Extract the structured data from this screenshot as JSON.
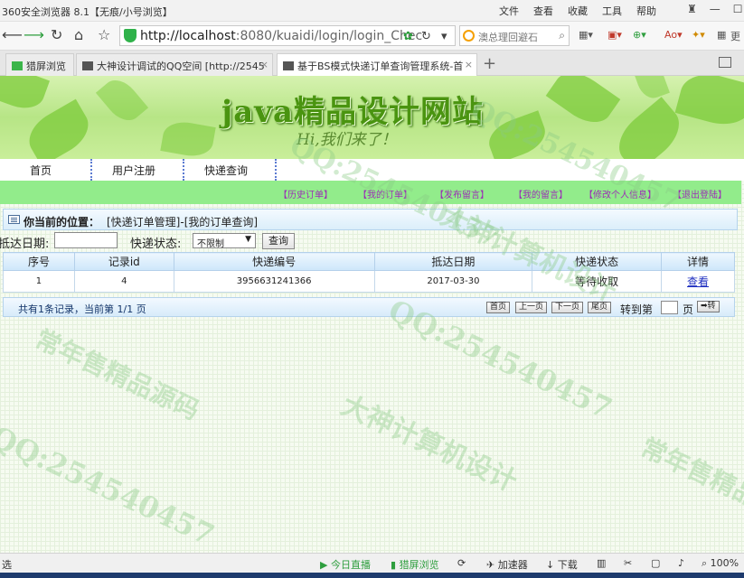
{
  "browser": {
    "window_title": "360安全浏览器 8.1【无痕/小号浏览】",
    "menu_items": [
      "文件",
      "查看",
      "收藏",
      "工具",
      "帮助"
    ],
    "url_host": "http://localhost",
    "url_rest": ":8080/kuaidi/login/login_Chec",
    "search_text": "澳总理回避石",
    "ext_label": "Ao",
    "more_label": "更",
    "tabs": [
      {
        "label": "猎屏浏览"
      },
      {
        "label": "大神设计调试的QQ空间 [http://2545"
      },
      {
        "label": "基于BS模式快递订单查询管理系统-首"
      }
    ]
  },
  "banner": {
    "title": "java精品设计网站",
    "subtitle": "Hi,我们来了！"
  },
  "top_nav": [
    "首页",
    "用户注册",
    "快递查询"
  ],
  "user_nav": [
    "【历史订单】",
    "【我的订单】",
    "【发布留言】",
    "【我的留言】",
    "【修改个人信息】",
    "【退出登陆】"
  ],
  "location": {
    "label": "你当前的位置：",
    "path": "[快递订单管理]-[我的订单查询]"
  },
  "filter": {
    "date_label": "抵达日期:",
    "date_value": "",
    "status_label": "快递状态:",
    "status_selected": "不限制",
    "query_button": "查询"
  },
  "table": {
    "headers": [
      "序号",
      "记录id",
      "快递编号",
      "抵达日期",
      "快递状态",
      "详情"
    ],
    "rows": [
      {
        "seq": "1",
        "record_id": "4",
        "number": "3956631241366",
        "date": "2017-03-30",
        "status": "等待收取",
        "detail": "查看"
      }
    ]
  },
  "pager": {
    "summary": "共有1条记录，当前第 1/1 页",
    "buttons": [
      "首页",
      "上一页",
      "下一页",
      "尾页"
    ],
    "goto_label": "转到第",
    "goto_value": "",
    "page_unit": "页",
    "go_button": "➡转"
  },
  "watermarks": {
    "qq": "QQ:254540457",
    "site1": "常年售精品源码",
    "site2": "大神计算机设计"
  },
  "statusbar": {
    "left": "选",
    "live": "今日直播",
    "screen": "猎屏浏览",
    "speed": "加速器",
    "download": "下载",
    "zoom": "100%"
  },
  "colors": {
    "nav_green": "#92ec8b",
    "user_link": "#9b2fb5",
    "banner_title": "#4a9410",
    "table_header": "#cde6fa"
  }
}
